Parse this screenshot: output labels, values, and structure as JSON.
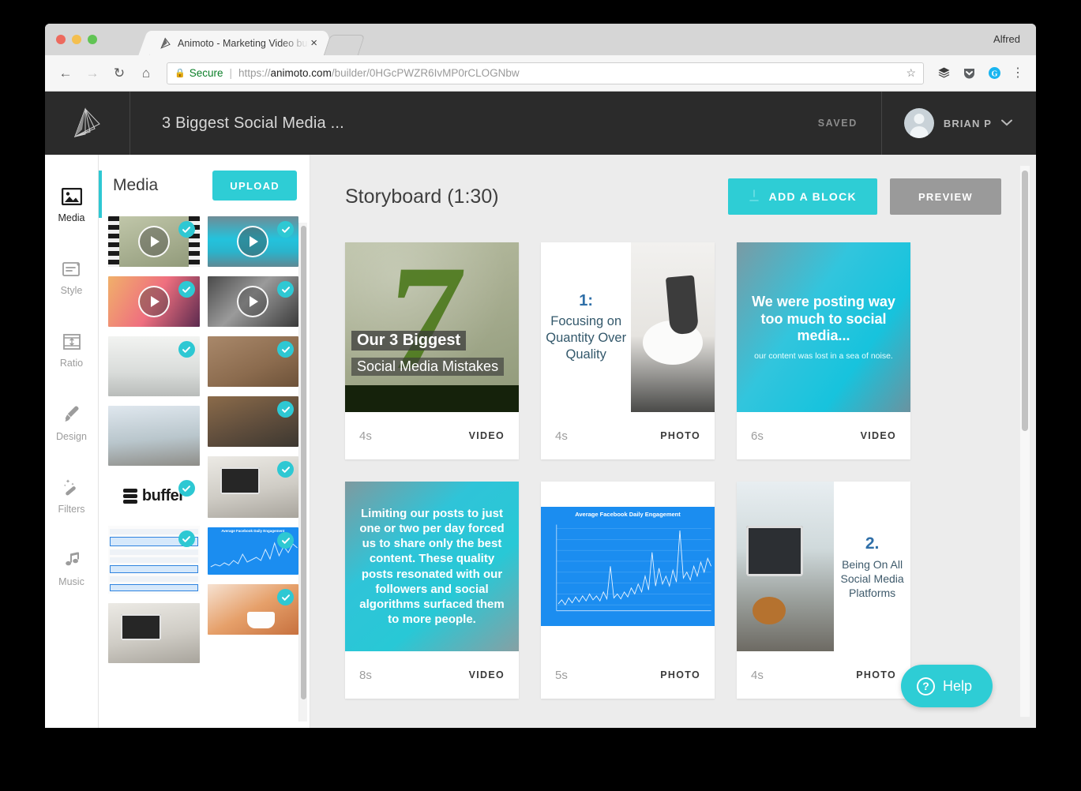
{
  "browser": {
    "tab": {
      "title": "Animoto - Marketing Video buil",
      "close_label": "×",
      "favicon": "animoto-logo-icon"
    },
    "profile_name": "Alfred",
    "nav": {
      "back": "←",
      "forward": "→",
      "reload": "↻",
      "home": "⌂"
    },
    "omnibox": {
      "lock_icon": "lock-icon",
      "secure_label": "Secure",
      "url_scheme": "https://",
      "url_host": "animoto.com",
      "url_path": "/builder/0HGcPWZR6IvMP0rCLOGNbw",
      "star_icon": "☆"
    },
    "extensions": [
      "layers-extension-icon",
      "pocket-extension-icon",
      "grammarly-extension-icon"
    ],
    "menu_icon": "⋮"
  },
  "app_header": {
    "logo": "animoto-wing-logo",
    "project_title": "3 Biggest Social Media ...",
    "save_status": "SAVED",
    "user_name": "BRIAN P",
    "caret": "⌄"
  },
  "sidebar": {
    "items": [
      {
        "label": "Media",
        "icon": "image-icon",
        "active": true
      },
      {
        "label": "Style",
        "icon": "style-card-icon",
        "active": false
      },
      {
        "label": "Ratio",
        "icon": "aspect-ratio-icon",
        "active": false
      },
      {
        "label": "Design",
        "icon": "paintbrush-icon",
        "active": false
      },
      {
        "label": "Filters",
        "icon": "magic-wand-icon",
        "active": false
      },
      {
        "label": "Music",
        "icon": "music-note-icon",
        "active": false
      }
    ]
  },
  "media_panel": {
    "title": "Media",
    "upload_label": "UPLOAD",
    "thumbnails": [
      {
        "name": "film-strip-video",
        "kind": "video",
        "selected": true,
        "art": "tv1",
        "col": 0
      },
      {
        "name": "teal-water-video",
        "kind": "video",
        "selected": true,
        "art": "tv2",
        "col": 1
      },
      {
        "name": "sunset-gradient-video",
        "kind": "video",
        "selected": true,
        "art": "tv3",
        "col": 0
      },
      {
        "name": "grayscale-video",
        "kind": "video",
        "selected": true,
        "art": "tv4",
        "col": 1
      },
      {
        "name": "white-office-photo",
        "kind": "photo",
        "selected": true,
        "art": "tp1",
        "col": 0
      },
      {
        "name": "writing-desk-photo",
        "kind": "photo",
        "selected": true,
        "art": "tp2",
        "col": 1
      },
      {
        "name": "laptop-window-photo",
        "kind": "photo",
        "selected": false,
        "art": "tp3",
        "col": 0
      },
      {
        "name": "wood-notebook-photo",
        "kind": "photo",
        "selected": true,
        "art": "tp4",
        "col": 1
      },
      {
        "name": "buffer-logo-photo",
        "kind": "photo",
        "selected": true,
        "art": "tbuf",
        "col": 0
      },
      {
        "name": "home-office-photo",
        "kind": "photo",
        "selected": true,
        "art": "tdesk",
        "col": 1
      },
      {
        "name": "spreadsheet-photo",
        "kind": "photo",
        "selected": true,
        "art": "tsheet",
        "col": 0
      },
      {
        "name": "engagement-chart-photo",
        "kind": "photo",
        "selected": true,
        "art": "tchart",
        "col": 1
      },
      {
        "name": "imac-desk-photo",
        "kind": "photo",
        "selected": false,
        "art": "tdesk",
        "col": 0
      },
      {
        "name": "coffee-cup-photo",
        "kind": "photo",
        "selected": true,
        "art": "tcoffee",
        "col": 1
      }
    ]
  },
  "storyboard": {
    "title": "Storyboard (1:30)",
    "add_block_label": "ADD A BLOCK",
    "add_block_icon": "plus-icon",
    "preview_label": "PREVIEW",
    "cards": [
      {
        "id": "card-1",
        "duration": "4s",
        "type": "VIDEO",
        "art": "s1",
        "text": {
          "headline": "Our 3 Biggest",
          "subline": "Social Media Mistakes"
        }
      },
      {
        "id": "card-2",
        "duration": "4s",
        "type": "PHOTO",
        "art": "s2",
        "text": {
          "number": "1:",
          "caption": "Focusing on Quantity Over Quality"
        }
      },
      {
        "id": "card-3",
        "duration": "6s",
        "type": "VIDEO",
        "art": "s3",
        "text": {
          "headline": "We were posting way too much to social media...",
          "subline": "our content was lost in a sea of noise."
        }
      },
      {
        "id": "card-4",
        "duration": "8s",
        "type": "VIDEO",
        "art": "s4",
        "text": {
          "body": "Limiting our posts to just one or two per day forced us to share only the best content. These quality posts resonated with our followers and social algorithms surfaced them to more people."
        }
      },
      {
        "id": "card-5",
        "duration": "5s",
        "type": "PHOTO",
        "art": "s5",
        "text": {
          "chart_title": "Average Facebook Daily Engagement"
        }
      },
      {
        "id": "card-6",
        "duration": "4s",
        "type": "PHOTO",
        "art": "s6",
        "text": {
          "number": "2.",
          "caption": "Being On All Social Media Platforms"
        }
      }
    ]
  },
  "help": {
    "label": "Help",
    "icon": "question-circle-icon"
  },
  "colors": {
    "accent_teal": "#2ecdd5",
    "header_dark": "#2b2b2b",
    "canvas_gray": "#ececec",
    "preview_gray": "#9a9a9a",
    "secure_green": "#0a7e27"
  }
}
